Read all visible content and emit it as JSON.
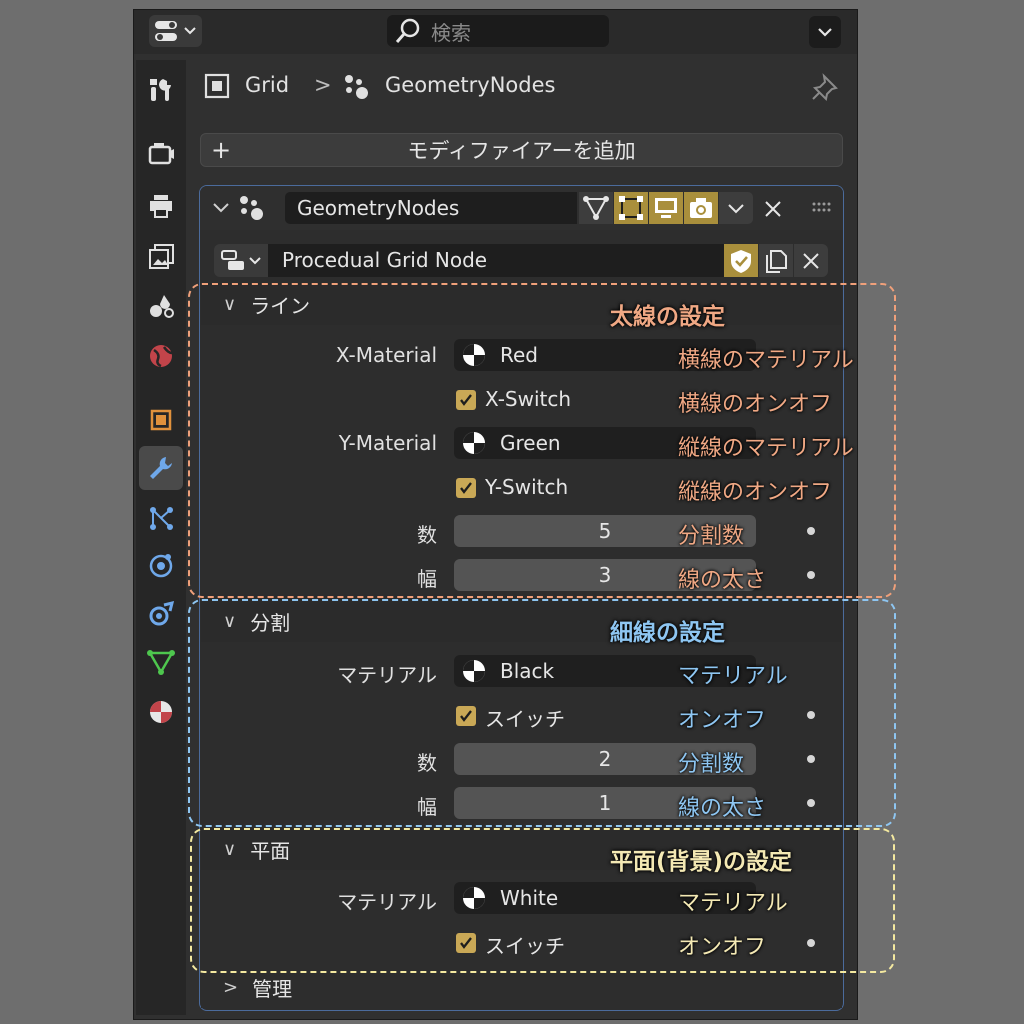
{
  "header": {
    "search_placeholder": "検索"
  },
  "breadcrumb": {
    "object": "Grid",
    "separator": ">",
    "modifier": "GeometryNodes"
  },
  "add_modifier_label": "モディファイアーを追加",
  "add_modifier_plus": "+",
  "modifier": {
    "name": "GeometryNodes",
    "node_group": "Procedual Grid Node"
  },
  "sections": {
    "line": {
      "title": "ライン",
      "x_material_label": "X-Material",
      "x_material_value": "Red",
      "x_switch_label": "X-Switch",
      "y_material_label": "Y-Material",
      "y_material_value": "Green",
      "y_switch_label": "Y-Switch",
      "count_label": "数",
      "count_value": "5",
      "width_label": "幅",
      "width_value": "3"
    },
    "division": {
      "title": "分割",
      "material_label": "マテリアル",
      "material_value": "Black",
      "switch_label": "スイッチ",
      "count_label": "数",
      "count_value": "2",
      "width_label": "幅",
      "width_value": "1"
    },
    "plane": {
      "title": "平面",
      "material_label": "マテリアル",
      "material_value": "White",
      "switch_label": "スイッチ"
    },
    "manage": {
      "title": "管理"
    }
  },
  "annotations": {
    "line_title": "太線の設定",
    "x_material": "横線のマテリアル",
    "x_switch": "横線のオンオフ",
    "y_material": "縦線のマテリアル",
    "y_switch": "縦線のオンオフ",
    "line_count": "分割数",
    "line_width": "線の太さ",
    "division_title": "細線の設定",
    "division_material": "マテリアル",
    "division_switch": "オンオフ",
    "division_count": "分割数",
    "division_width": "線の太さ",
    "plane_title": "平面(背景)の設定",
    "plane_material": "マテリアル",
    "plane_switch": "オンオフ"
  },
  "colors": {
    "line_box": "#f0a07a",
    "division_box": "#8ec6f2",
    "plane_box": "#f4e9a0",
    "accent": "#c9a856"
  }
}
